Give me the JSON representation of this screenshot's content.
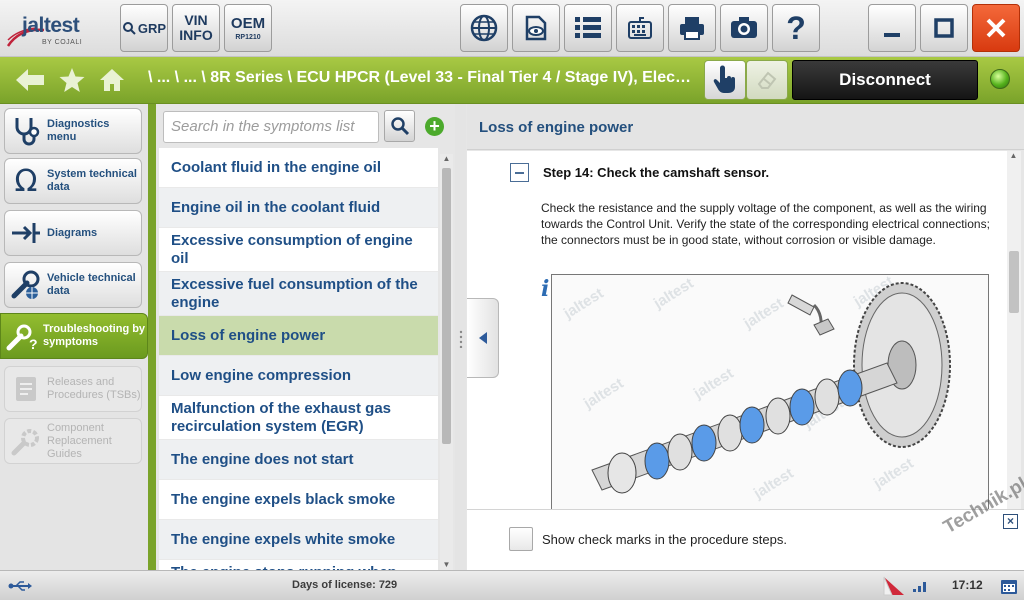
{
  "app": {
    "logo_brand": "jaltest",
    "logo_sub": "BY COJALI"
  },
  "toolbar": {
    "grp_label": "GRP",
    "vin_line1": "VIN",
    "vin_line2": "INFO",
    "oem_label": "OEM",
    "oem_sub": "RP1210",
    "help_label": "?"
  },
  "nav": {
    "breadcrumb": "\\ ... \\ ... \\ 8R Series \\ ECU HPCR (Level 33 - Final Tier 4 / Stage IV), Electr...",
    "disconnect_label": "Disconnect"
  },
  "sidebar": {
    "items": [
      {
        "label": "Diagnostics menu",
        "state": "normal"
      },
      {
        "label": "System technical data",
        "state": "normal"
      },
      {
        "label": "Diagrams",
        "state": "normal"
      },
      {
        "label": "Vehicle technical data",
        "state": "normal"
      },
      {
        "label": "Troubleshooting by symptoms",
        "state": "active"
      },
      {
        "label": "Releases and Procedures (TSBs)",
        "state": "disabled"
      },
      {
        "label": "Component Replacement Guides",
        "state": "disabled"
      }
    ]
  },
  "symptoms": {
    "search_placeholder": "Search in the symptoms list",
    "add_label": "+",
    "items": [
      "Coolant fluid in the engine oil",
      "Engine oil in the coolant fluid",
      "Excessive consumption of engine oil",
      "Excessive fuel consumption of the engine",
      "Loss of engine power",
      "Low engine compression",
      "Malfunction of the exhaust gas recirculation system (EGR)",
      "The engine does not start",
      "The engine expels black smoke",
      "The engine expels white smoke",
      "The engine stops running when..."
    ],
    "selected_index": 4
  },
  "detail": {
    "title": "Loss of engine power",
    "step_title": "Step 14: Check the camshaft sensor.",
    "step_text": "Check the resistance and the supply voltage of the component, as well as the wiring towards the Control Unit. Verify the state of the corresponding electrical connections; the connectors must be in good state, without corrosion or visible damage.",
    "info_icon": "i",
    "watermark": "jaltest",
    "footer_check_label": "Show check marks in the procedure steps.",
    "close_label": "×"
  },
  "status": {
    "license": "Days of license: 729",
    "time": "17:12"
  },
  "site_watermark": "Technik.pl",
  "colors": {
    "accent_green": "#7aa32a",
    "link_blue": "#1f4f86",
    "close_red": "#e04a1c"
  }
}
